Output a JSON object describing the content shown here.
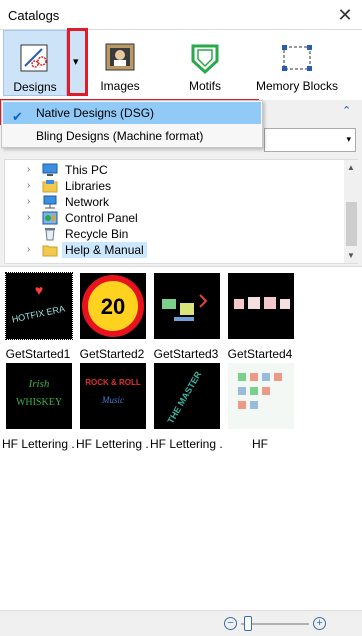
{
  "panel": {
    "title": "Catalogs",
    "close_glyph": "✕"
  },
  "toolbar": {
    "designs_label": "Designs",
    "images_label": "Images",
    "motifs_label": "Motifs",
    "memory_label": "Memory Blocks",
    "dropdown_glyph": "▾"
  },
  "menu": {
    "items": [
      {
        "label": "Native Designs (DSG)",
        "checked": true
      },
      {
        "label": "Bling Designs (Machine format)",
        "checked": false
      }
    ],
    "check_glyph": "✔"
  },
  "collapse_glyph": "⌃",
  "tree": {
    "items": [
      {
        "label": "This PC",
        "icon": "computer-icon"
      },
      {
        "label": "Libraries",
        "icon": "libraries-icon"
      },
      {
        "label": "Network",
        "icon": "network-icon"
      },
      {
        "label": "Control Panel",
        "icon": "control-panel-icon"
      },
      {
        "label": "Recycle Bin",
        "icon": "recycle-bin-icon"
      },
      {
        "label": "Help & Manual",
        "icon": "folder-icon"
      }
    ],
    "expand_glyph": "›"
  },
  "gallery": {
    "items": [
      {
        "caption": "GetStarted1"
      },
      {
        "caption": "GetStarted2"
      },
      {
        "caption": "GetStarted3"
      },
      {
        "caption": "GetStarted4"
      },
      {
        "caption": "HF Lettering ..."
      },
      {
        "caption": "HF Lettering ..."
      },
      {
        "caption": "HF Lettering ..."
      },
      {
        "caption": "HF"
      }
    ],
    "thumb2_text": "20",
    "thumb1_text": "HOTFIX ERA",
    "thumb5_text": "WHISKEY",
    "thumb6_text": "ROCK & ROLL",
    "thumb7_text": "THE MASTER"
  },
  "colors": {
    "accent": "#cde3f7",
    "highlight": "#91c9f7",
    "annotation": "#e01b2a"
  }
}
